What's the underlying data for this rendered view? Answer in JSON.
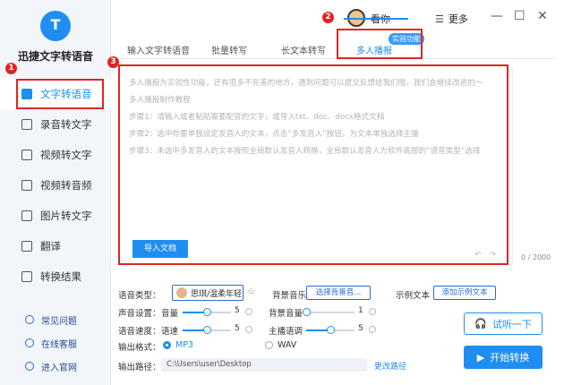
{
  "app": {
    "name": "迅捷文字转语音"
  },
  "sidebar": {
    "items": [
      {
        "label": "文字转语音",
        "icon": "text-to-speech-icon"
      },
      {
        "label": "录音转文字",
        "icon": "recording-icon"
      },
      {
        "label": "视频转文字",
        "icon": "video-text-icon"
      },
      {
        "label": "视频转音频",
        "icon": "video-audio-icon"
      },
      {
        "label": "图片转文字",
        "icon": "image-text-icon"
      },
      {
        "label": "翻译",
        "icon": "translate-icon"
      },
      {
        "label": "转换结果",
        "icon": "results-icon"
      }
    ],
    "bottom_links": [
      {
        "label": "常见问题",
        "icon": "question-icon"
      },
      {
        "label": "在线客服",
        "icon": "headset-icon"
      },
      {
        "label": "进入官网",
        "icon": "website-icon"
      }
    ]
  },
  "header": {
    "username": "看你",
    "more_label": "更多",
    "hamburger": "☰",
    "minimize": "—",
    "maximize": "☐",
    "close": "✕"
  },
  "tabs": [
    {
      "label": "输入文字转语音"
    },
    {
      "label": "批量转写"
    },
    {
      "label": "长文本转写"
    },
    {
      "label": "多人播报"
    }
  ],
  "tab_badge": "实验功能",
  "editor": {
    "lines": [
      "多人播报为实验性功能，还有很多不完善的地方，遇到问题可以提交反馈给我们哦，我们会继续改进的～",
      "多人播报制作教程",
      "步骤1：请输入或者粘贴需要配音的文字，或导入txt、doc、docx格式文档",
      "步骤2：选中你要单独设定发音人的文本，点击“多发音人”按钮，为文本单独选择主播",
      "步骤3：未选中多发音人的文本按照全局默认发音人转换，全局默认发音人为软件底部的“语音类型”选择"
    ],
    "import_label": "导入文档",
    "undo": "↶",
    "redo": "↷",
    "char_count": "0 / 2000"
  },
  "settings": {
    "voice_type_label": "语音类型：",
    "voice_value": "思琪/温柔年轻",
    "bg_music_label": "背景音乐",
    "bg_music_button": "选择背景音...",
    "example_label": "示例文本",
    "example_button": "添加示例文本",
    "voice_settings_label": "声音设置：",
    "volume_label": "音量",
    "volume_value": "5",
    "bg_volume_label": "背景音量",
    "bg_volume_value": "1",
    "speed_settings_label": "语音速度：",
    "speed_label": "语速",
    "speed_value": "5",
    "pitch_label": "主播语调",
    "pitch_value": "5",
    "format_label": "输出格式：",
    "format_mp3": "MP3",
    "format_wav": "WAV",
    "path_label": "输出路径：",
    "path_value": "C:\\Users\\user\\Desktop",
    "change_path": "更改路径",
    "volume_level": 0.5,
    "bg_volume_level": 0.0,
    "speed_level": 0.5,
    "pitch_level": 0.5
  },
  "buttons": {
    "listen": "试听一下",
    "start": "开始转换"
  },
  "annotations": [
    "1",
    "2",
    "3"
  ],
  "colors": {
    "accent": "#1f8ef1",
    "annotation": "#e02424"
  }
}
